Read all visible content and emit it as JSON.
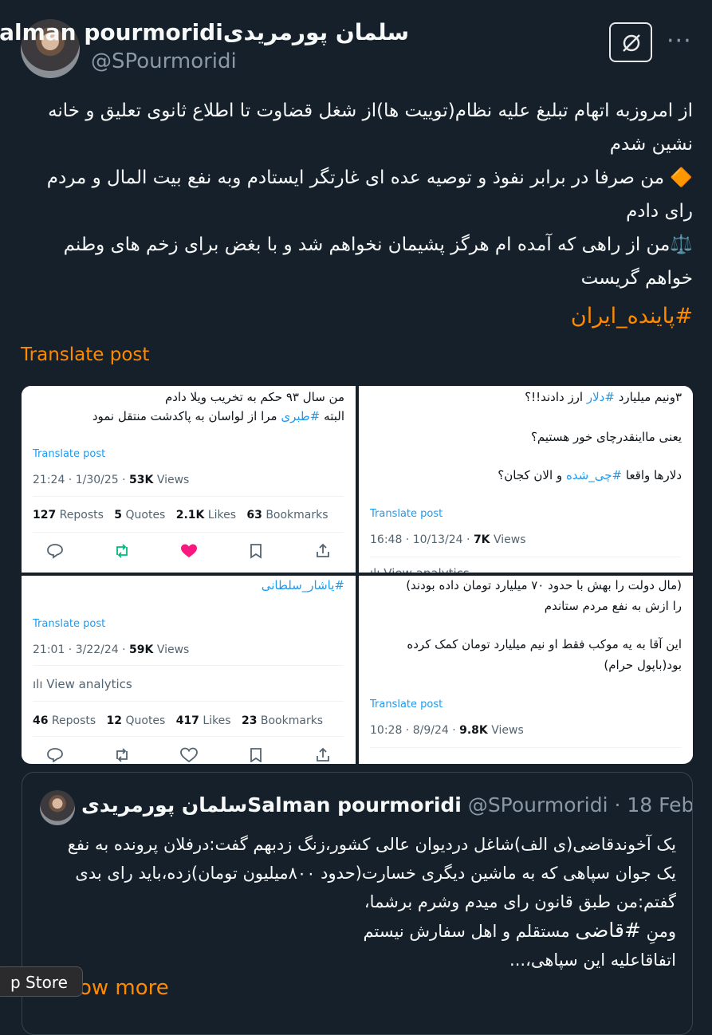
{
  "author": {
    "display_name": "سلمان پورمریدیSalman pourmoridi",
    "handle": "@SPourmoridi"
  },
  "post": {
    "lines": [
      "از امروزبه اتهام تبلیغ علیه نظام(توییت ها)از شغل قضاوت تا اطلاع ثانوی تعلیق و خانه نشین شدم",
      "🔶 من صرفا در برابر نفوذ و توصیه عده ای غارتگر ایستادم وبه نفع بیت المال و مردم رای دادم",
      "⚖️من از راهی که آمده ام هرگز پشیمان نخواهم شد و با بغض برای زخم های وطنم خواهم گریست"
    ],
    "hashtag": "#پاینده_ایران",
    "translate_label": "Translate post"
  },
  "grid": {
    "cell1": {
      "line1": "من سال ۹۳ حکم به تخریب ویلا دادم",
      "line2_pre": "البته ",
      "line2_tag": "#طبری",
      "line2_post": " مرا از لواسان به پاکدشت منتقل نمود",
      "translate": "Translate post",
      "time": "21:24 · 1/30/25 · ",
      "views_num": "53K",
      "views_label": " Views",
      "reposts": "127",
      "reposts_label": " Reposts",
      "quotes": "5",
      "quotes_label": " Quotes",
      "likes": "2.1K",
      "likes_label": " Likes",
      "bookmarks": "63",
      "bookmarks_label": " Bookmarks"
    },
    "cell2": {
      "line1_pre": "۳ونیم میلیارد ",
      "line1_tag": "#دلار",
      "line1_post": " ارز دادند!!؟",
      "line2": "یعنی مااینقدرچای خور هستیم؟",
      "line3_pre": "دلارها واقعا ",
      "line3_tag": "#چی_شده",
      "line3_post": " و الان کجان؟",
      "translate": "Translate post",
      "time": "16:48 · 10/13/24 · ",
      "views_num": "7K",
      "views_label": " Views",
      "analytics": "View analytics"
    },
    "cell3": {
      "tag": "#یاشار_سلطانی",
      "translate": "Translate post",
      "time": "21:01 · 3/22/24 · ",
      "views_num": "59K",
      "views_label": " Views",
      "analytics": "View analytics",
      "reposts": "46",
      "reposts_label": " Reposts",
      "quotes": "12",
      "quotes_label": " Quotes",
      "likes": "417",
      "likes_label": " Likes",
      "bookmarks": "23",
      "bookmarks_label": " Bookmarks"
    },
    "cell4": {
      "line1": "(مال دولت را بهش با حدود ۷۰ میلیارد تومان داده بودند)",
      "line2": "را ازش به نفع مردم ستاندم",
      "line3": "این آقا به یه موکب فقط او نیم میلیارد تومان کمک کرده",
      "line4": "بود(باپول حرام)",
      "translate": "Translate post",
      "time": "10:28 · 8/9/24 · ",
      "views_num": "9.8K",
      "views_label": " Views"
    }
  },
  "quote": {
    "name": "سلمان پورمریدیSalman pourmoridi",
    "handle": "@SPourmoridi",
    "date": "· 18 Feb",
    "lines": [
      "یک آخوندقاضی(ی الف)شاغل دردیوان عالی کشور،زنگ زدبهم گفت:درفلان پرونده به نفع",
      "یک جوان سپاهی که به ماشین دیگری خسارت(حدود ۸۰۰میلیون تومان)زده،باید رای بدی",
      "گفتم:من طبق قانون رای میدم وشرم برشما،",
      "ومنِ ",
      "#قاضی",
      " مستقلم و اهل سفارش نیستم",
      "اتفاقاعلیه این سپاهی،..."
    ],
    "show_more": "Show more"
  },
  "tooltip": "p Store",
  "colors": {
    "accent": "#ff8a00",
    "link": "#1d9bf0",
    "like": "#f91880",
    "repost": "#00ba7c"
  }
}
